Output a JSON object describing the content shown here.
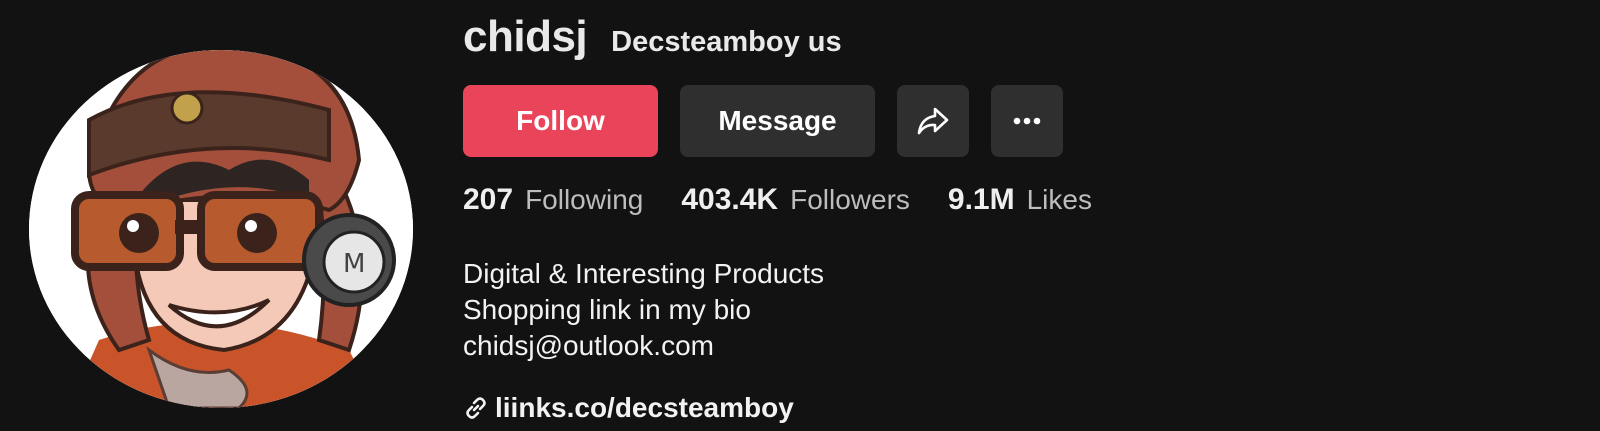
{
  "profile": {
    "username": "chidsj",
    "nickname": "Decsteamboy us",
    "avatar_icon": "avatar-aviator-cartoon"
  },
  "actions": {
    "follow_label": "Follow",
    "message_label": "Message",
    "share_icon": "share-icon",
    "more_icon": "more-icon"
  },
  "stats": {
    "following": {
      "count": "207",
      "label": "Following"
    },
    "followers": {
      "count": "403.4K",
      "label": "Followers"
    },
    "likes": {
      "count": "9.1M",
      "label": "Likes"
    }
  },
  "bio": {
    "lines": [
      "Digital & Interesting Products",
      "Shopping link in my bio",
      "chidsj@outlook.com"
    ]
  },
  "link": {
    "icon": "link-icon",
    "text": "liinks.co/decsteamboy"
  },
  "colors": {
    "background": "#121212",
    "follow": "#ea445a",
    "secondary_button": "#2f2f2f"
  }
}
